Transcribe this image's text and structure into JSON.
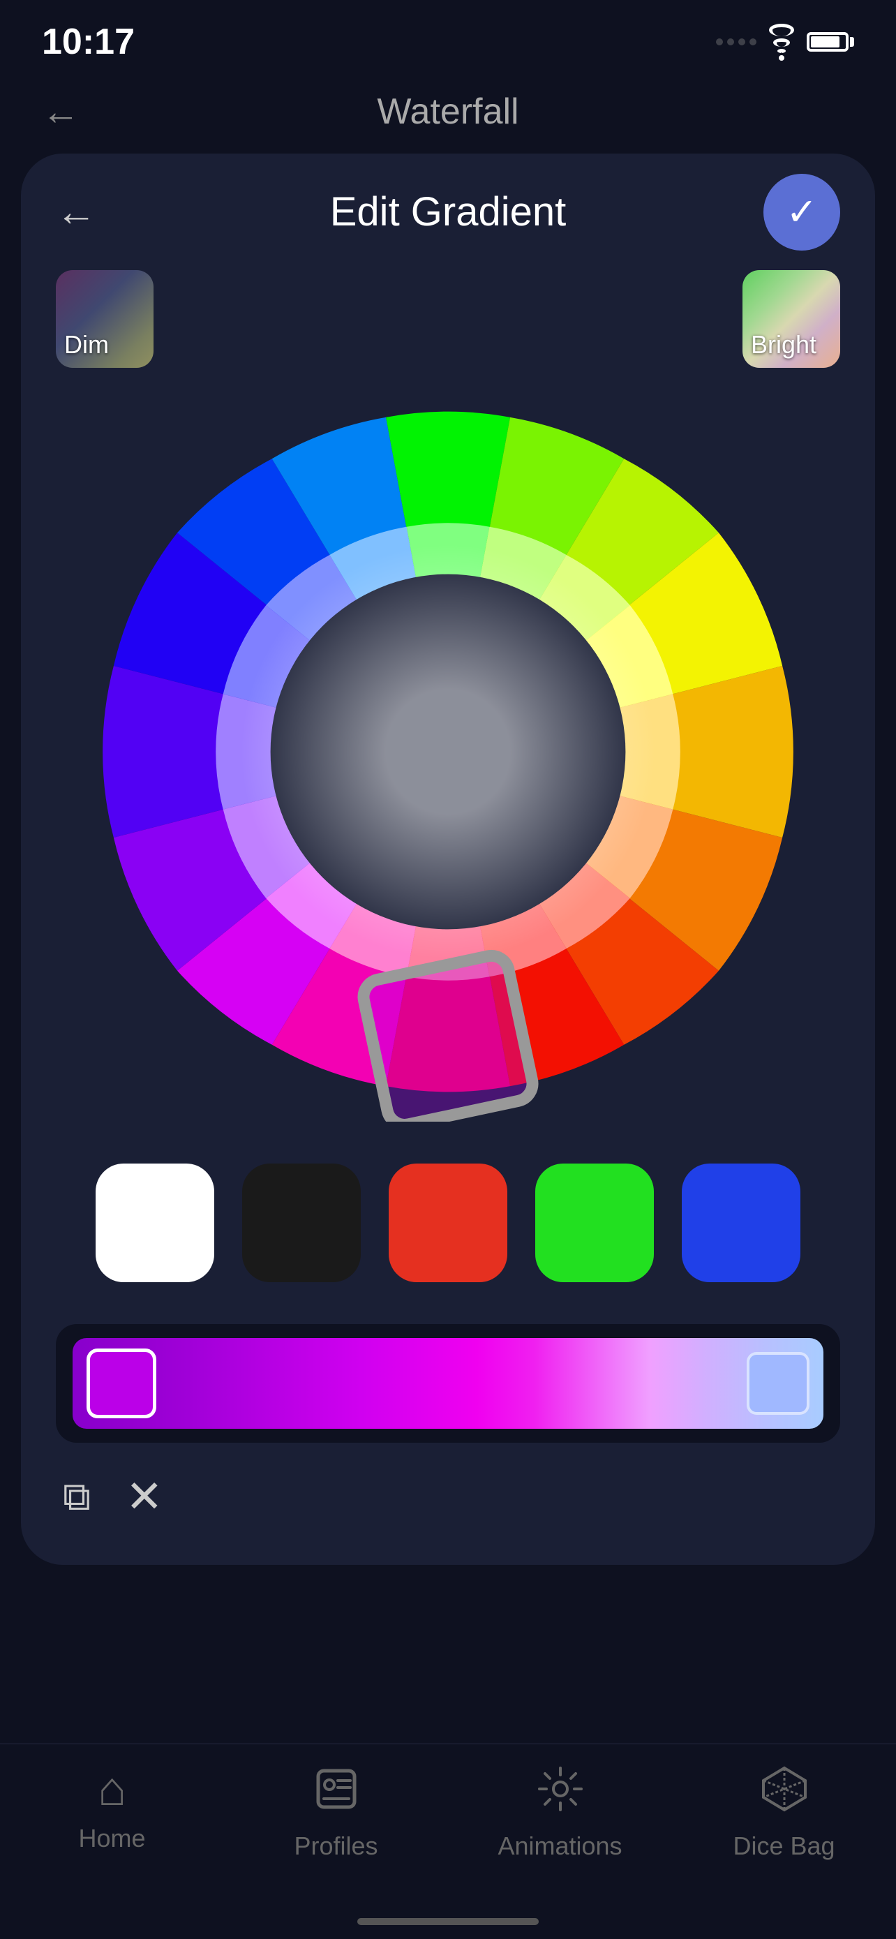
{
  "status": {
    "time": "10:17"
  },
  "top_nav": {
    "back_label": "←",
    "title": "Waterfall"
  },
  "card": {
    "title": "Edit Gradient",
    "back_label": "←",
    "confirm_label": "✓"
  },
  "presets": {
    "dim_label": "Dim",
    "bright_label": "Bright"
  },
  "swatches": {
    "white_label": "white",
    "black_label": "black",
    "red_label": "red",
    "green_label": "green",
    "blue_label": "blue"
  },
  "actions": {
    "copy_label": "copy",
    "close_label": "close"
  },
  "tabs": {
    "home_label": "Home",
    "profiles_label": "Profiles",
    "animations_label": "Animations",
    "dice_bag_label": "Dice Bag"
  }
}
